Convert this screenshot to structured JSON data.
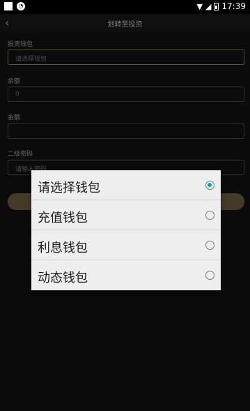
{
  "status_bar": {
    "time": "17:39"
  },
  "header": {
    "back_label": "‹",
    "title": "划转至投资"
  },
  "form": {
    "wallet_label": "投资钱包",
    "wallet_value": "请选择钱包",
    "balance_label": "余额",
    "balance_value": "0",
    "amount_label": "金额",
    "amount_value": "",
    "password_label": "二级密码",
    "password_placeholder": "请输入密码"
  },
  "dialog": {
    "options": [
      {
        "label": "请选择钱包",
        "selected": true
      },
      {
        "label": "充值钱包",
        "selected": false
      },
      {
        "label": "利息钱包",
        "selected": false
      },
      {
        "label": "动态钱包",
        "selected": false
      }
    ]
  },
  "colors": {
    "accent": "#a8946a",
    "radio_selected": "#2b9a8c",
    "background": "#141414"
  }
}
